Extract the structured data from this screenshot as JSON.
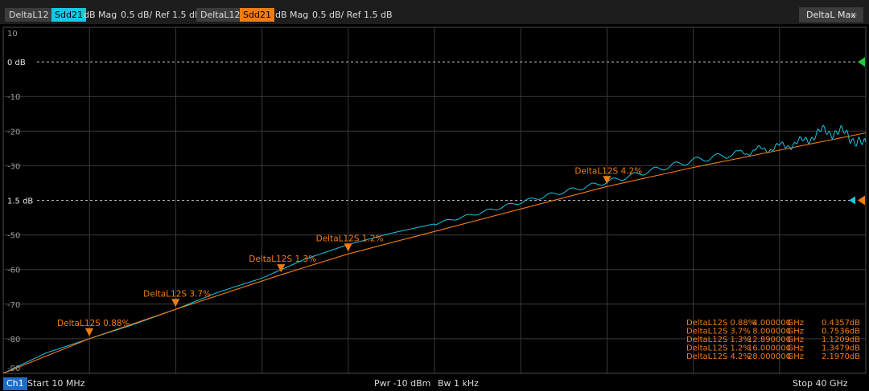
{
  "header": {
    "trace1_name": "DeltaL12",
    "trace1_param": "Sdd21",
    "trace1_format": "dB Mag",
    "trace1_scale": "0.5 dB/ Ref 1.5 dB",
    "trace2_name": "DeltaL12S",
    "trace2_param": "Sdd21",
    "trace2_format": "dB Mag",
    "trace2_scale": "0.5 dB/ Ref 1.5 dB",
    "dropdown_label": "DeltaL Max"
  },
  "footer": {
    "channel": "Ch1",
    "start": "Start   10 MHz",
    "pwr": "Pwr   -10 dBm",
    "bw": "Bw   1 kHz",
    "stop": "Stop   40 GHz"
  },
  "colors": {
    "trace_cyan": "#14c8e6",
    "trace_orange": "#f07d14",
    "ref_green": "#22c83c",
    "grid": "#3a3a3a"
  },
  "chart_data": {
    "type": "line",
    "x_unit": "GHz",
    "xlim": [
      0.01,
      40
    ],
    "ylim": [
      0,
      10
    ],
    "y_tick_labels": [
      "10",
      "0 dB",
      "-10",
      "-20",
      "-30",
      "1.5 dB",
      "-50",
      "-60",
      "-70",
      "-80",
      "-90"
    ],
    "ref_lines": [
      {
        "label": "0 dB",
        "value": 9
      },
      {
        "label": "1.5 dB",
        "value": 5
      }
    ],
    "series": [
      {
        "name": "DeltaL12 Sdd21",
        "color": "#14c8e6",
        "x": [
          0.01,
          2,
          4,
          6,
          8,
          10,
          12,
          14,
          16,
          18,
          20,
          22,
          24,
          26,
          28,
          30,
          32,
          34,
          35,
          36,
          37,
          38,
          39,
          40
        ],
        "y": [
          0.0,
          0.59,
          1.0,
          1.4,
          1.85,
          2.35,
          2.75,
          3.3,
          3.72,
          4.05,
          4.32,
          4.62,
          4.95,
          5.25,
          5.53,
          5.85,
          6.15,
          6.35,
          6.45,
          6.55,
          6.68,
          7.0,
          6.95,
          6.55
        ]
      },
      {
        "name": "DeltaL12S Sdd21",
        "color": "#f07d14",
        "x": [
          0.01,
          4,
          8,
          12.89,
          16,
          20,
          24,
          28,
          32,
          36,
          40
        ],
        "y": [
          0.0,
          1.0,
          1.85,
          2.85,
          3.45,
          4.1,
          4.75,
          5.4,
          5.95,
          6.45,
          6.95
        ]
      }
    ],
    "markers": [
      {
        "label": "DeltaL12S 0.88%",
        "x": 4.0,
        "y": 1.0
      },
      {
        "label": "DeltaL12S 3.7%",
        "x": 8.0,
        "y": 1.85
      },
      {
        "label": "DeltaL12S 1.3%",
        "x": 12.89,
        "y": 2.85
      },
      {
        "label": "DeltaL12S 1.2%",
        "x": 16.0,
        "y": 3.45
      },
      {
        "label": "DeltaL12S 4.2%",
        "x": 28.0,
        "y": 5.4
      }
    ],
    "marker_table": [
      {
        "name": "DeltaL12S 0.88%",
        "freq": "4.000000",
        "freq_unit": "GHz",
        "value": "0.4357",
        "value_unit": "dB"
      },
      {
        "name": "DeltaL12S 3.7%",
        "freq": "8.000000",
        "freq_unit": "GHz",
        "value": "0.7536",
        "value_unit": "dB"
      },
      {
        "name": "DeltaL12S 1.3%",
        "freq": "12.890000",
        "freq_unit": "GHz",
        "value": "1.1209",
        "value_unit": "dB"
      },
      {
        "name": "DeltaL12S 1.2%",
        "freq": "16.000000",
        "freq_unit": "GHz",
        "value": "1.3479",
        "value_unit": "dB"
      },
      {
        "name": "DeltaL12S 4.2%",
        "freq": "28.000000",
        "freq_unit": "GHz",
        "value": "2.1970",
        "value_unit": "dB"
      }
    ]
  }
}
